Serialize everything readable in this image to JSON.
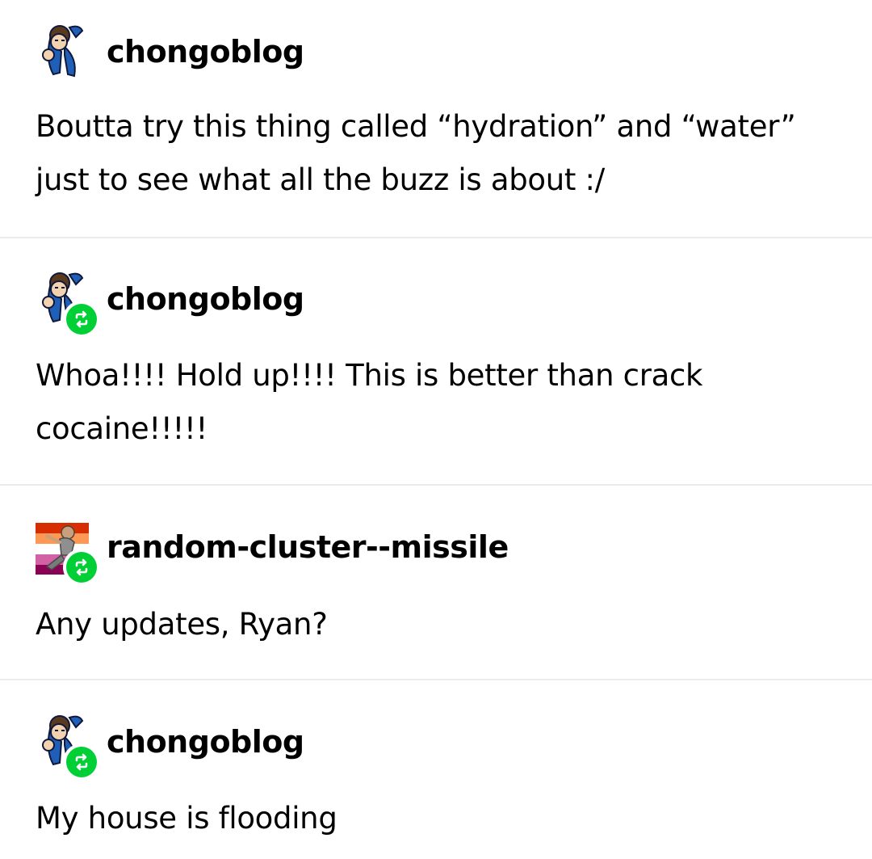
{
  "posts": [
    {
      "username": "chongoblog",
      "avatar_icon": "chongoblog-avatar-icon",
      "is_reblog": false,
      "text": "Boutta try this thing called “hydration” and “water” just to see what all the buzz is about :/"
    },
    {
      "username": "chongoblog",
      "avatar_icon": "chongoblog-avatar-icon",
      "is_reblog": true,
      "text": "Whoa!!!! Hold up!!!! This is better than crack cocaine!!!!!"
    },
    {
      "username": "random-cluster--missile",
      "avatar_icon": "random-cluster-missile-avatar-icon",
      "is_reblog": true,
      "text": "Any updates, Ryan?"
    },
    {
      "username": "chongoblog",
      "avatar_icon": "chongoblog-avatar-icon",
      "is_reblog": true,
      "text": "My house is flooding"
    }
  ],
  "colors": {
    "reblog_badge": "#00cf35",
    "divider": "#ebebeb",
    "text": "#000000",
    "background": "#ffffff"
  }
}
